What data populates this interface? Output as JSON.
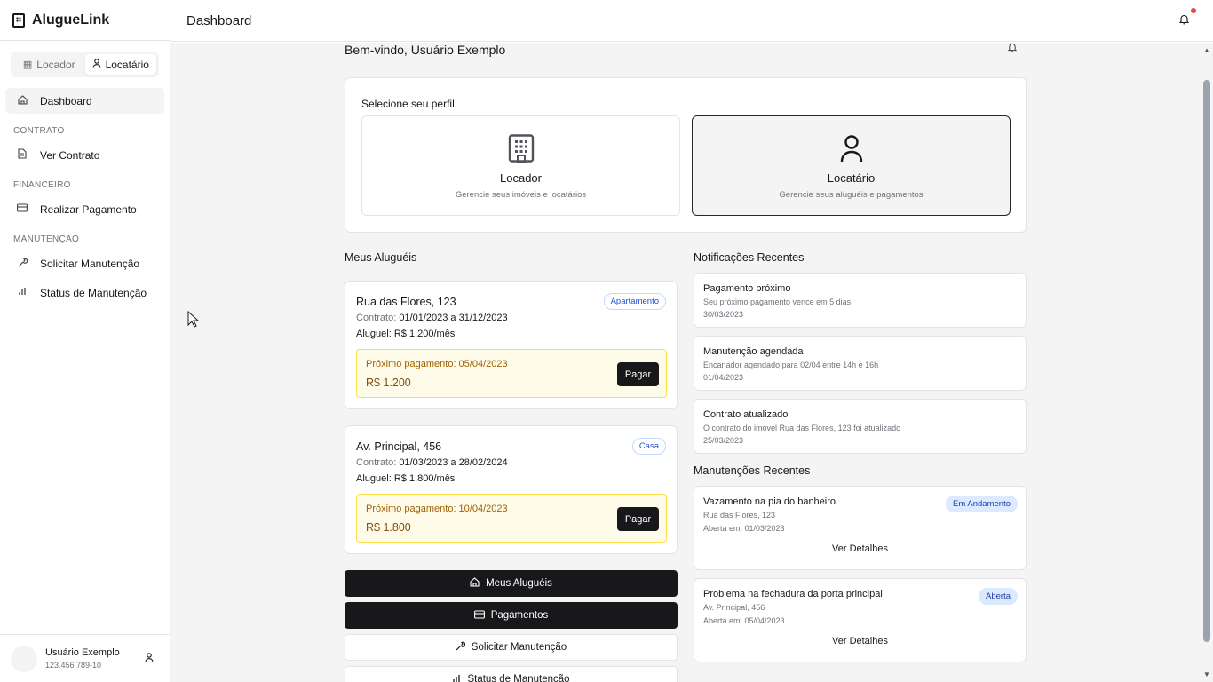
{
  "app": {
    "name": "AlugueLink"
  },
  "sidebar": {
    "roles": [
      {
        "label": "Locador",
        "icon": "building-icon",
        "active": false
      },
      {
        "label": "Locatário",
        "icon": "user-icon",
        "active": true
      }
    ],
    "dashboard_label": "Dashboard",
    "sections": [
      {
        "title": "CONTRATO",
        "items": [
          {
            "label": "Ver Contrato",
            "icon": "file-icon"
          }
        ]
      },
      {
        "title": "FINANCEIRO",
        "items": [
          {
            "label": "Realizar Pagamento",
            "icon": "credit-card-icon"
          }
        ]
      },
      {
        "title": "MANUTENÇÃO",
        "items": [
          {
            "label": "Solicitar Manutenção",
            "icon": "wrench-icon"
          },
          {
            "label": "Status de Manutenção",
            "icon": "bar-chart-icon"
          }
        ]
      }
    ],
    "user": {
      "name": "Usuário Exemplo",
      "cpf": "123.456.789-10"
    }
  },
  "header": {
    "title": "Dashboard",
    "notification_dot_color": "#ef4444"
  },
  "main": {
    "welcome": "Bem-vindo, Usuário Exemplo",
    "profile": {
      "label": "Selecione seu perfil",
      "options": [
        {
          "name": "Locador",
          "desc": "Gerencie seus imóveis e locatários",
          "icon": "building-icon",
          "selected": false
        },
        {
          "name": "Locatário",
          "desc": "Gerencie seus aluguéis e pagamentos",
          "icon": "user-icon",
          "selected": true
        }
      ]
    },
    "rentals_title": "Meus Aluguéis",
    "rentals": [
      {
        "address": "Rua das Flores, 123",
        "type": "Apartamento",
        "contract_label": "Contrato:",
        "contract": "01/01/2023 a 31/12/2023",
        "rent_label": "Aluguel:",
        "rent": "R$ 1.200/mês",
        "next_payment": "Próximo pagamento: 05/04/2023",
        "amount": "R$ 1.200",
        "pay_label": "Pagar"
      },
      {
        "address": "Av. Principal, 456",
        "type": "Casa",
        "contract_label": "Contrato:",
        "contract": "01/03/2023 a 28/02/2024",
        "rent_label": "Aluguel:",
        "rent": "R$ 1.800/mês",
        "next_payment": "Próximo pagamento: 10/04/2023",
        "amount": "R$ 1.800",
        "pay_label": "Pagar"
      }
    ],
    "actions": [
      {
        "label": "Meus Aluguéis",
        "icon": "home-icon",
        "style": "dark"
      },
      {
        "label": "Pagamentos",
        "icon": "credit-card-icon",
        "style": "dark"
      },
      {
        "label": "Solicitar Manutenção",
        "icon": "wrench-icon",
        "style": "light"
      },
      {
        "label": "Status de Manutenção",
        "icon": "bar-chart-icon",
        "style": "light"
      }
    ],
    "notifications_title": "Notificações Recentes",
    "notifications": [
      {
        "title": "Pagamento próximo",
        "desc": "Seu próximo pagamento vence em 5 dias",
        "date": "30/03/2023"
      },
      {
        "title": "Manutenção agendada",
        "desc": "Encanador agendado para 02/04 entre 14h e 16h",
        "date": "01/04/2023"
      },
      {
        "title": "Contrato atualizado",
        "desc": "O contrato do imóvel Rua das Flores, 123 foi atualizado",
        "date": "25/03/2023"
      }
    ],
    "maintenance_title": "Manutenções Recentes",
    "maintenance": [
      {
        "title": "Vazamento na pia do banheiro",
        "status": "Em Andamento",
        "address": "Rua das Flores, 123",
        "opened": "Aberta em: 01/03/2023",
        "details": "Ver Detalhes"
      },
      {
        "title": "Problema na fechadura da porta principal",
        "status": "Aberta",
        "address": "Av. Principal, 456",
        "opened": "Aberta em: 05/04/2023",
        "details": "Ver Detalhes"
      }
    ]
  }
}
